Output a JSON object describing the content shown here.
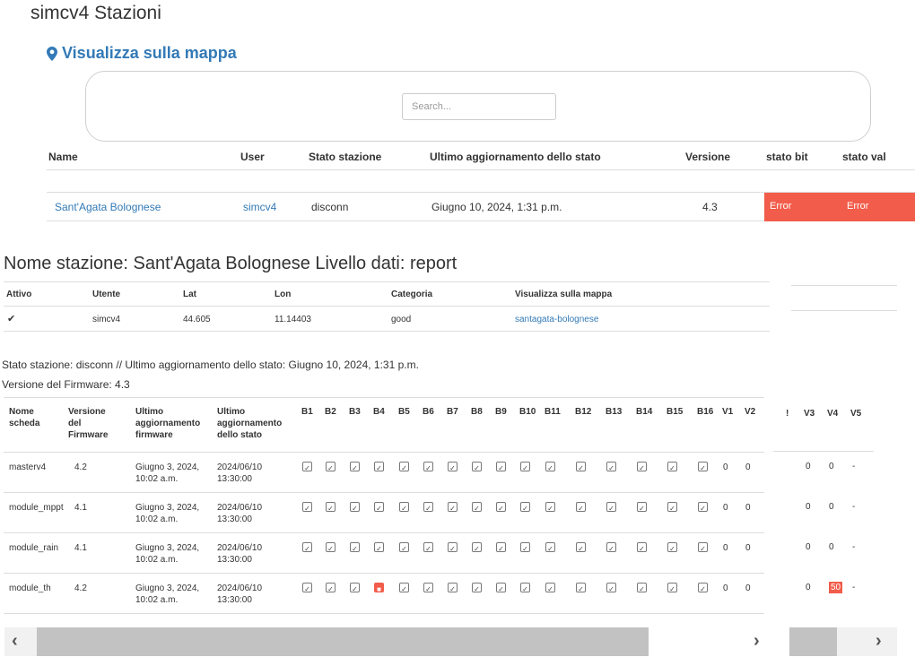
{
  "page": {
    "title": "simcv4 Stazioni",
    "map_link": "Visualizza sulla mappa",
    "search_placeholder": "Search..."
  },
  "stations_table": {
    "headers": [
      "Name",
      "User",
      "Stato stazione",
      "Ultimo aggiornamento dello stato",
      "Versione",
      "stato bit",
      "stato val"
    ],
    "rows": [
      {
        "name": "Sant'Agata Bolognese",
        "user": "simcv4",
        "stato": "disconn",
        "ultimo": "Giugno 10, 2024, 1:31 p.m.",
        "versione": "4.3",
        "stato_bit": "Error",
        "stato_val": "Error"
      }
    ]
  },
  "detail": {
    "title": "Nome stazione: Sant'Agata Bolognese Livello dati: report",
    "info_headers": [
      "Attivo",
      "Utente",
      "Lat",
      "Lon",
      "Categoria",
      "Visualizza sulla mappa"
    ],
    "info_values": {
      "attivo_icon": "checkmark-icon",
      "utente": "simcv4",
      "lat": "44.605",
      "lon": "11.14403",
      "categoria": "good",
      "mappa_link": "santagata-bolognese"
    },
    "status_line": "Stato stazione: disconn // Ultimo aggiornamento dello stato: Giugno 10, 2024, 1:31 p.m.",
    "firmware_line": "Versione del Firmware: 4.3"
  },
  "boards_table": {
    "headers": {
      "nome": "Nome\nscheda",
      "versione": "Versione\ndel\nFirmware",
      "ultimo_fw": "Ultimo\naggiornamento\nfirmware",
      "ultimo_stato": "Ultimo\naggiornamento\ndello stato",
      "bits": [
        "B1",
        "B2",
        "B3",
        "B4",
        "B5",
        "B6",
        "B7",
        "B8",
        "B9",
        "B10",
        "B11",
        "B12",
        "B13",
        "B14",
        "B15",
        "B16"
      ],
      "vals": [
        "V1",
        "V2"
      ],
      "right_vals": [
        "!",
        "V3",
        "V4",
        "V5"
      ]
    },
    "rows": [
      {
        "nome": "masterv4",
        "versione": "4.2",
        "ultimo_fw": "Giugno 3, 2024,\n10:02 a.m.",
        "ultimo_stato": "2024/06/10\n13:30:00",
        "bad_bits": [],
        "v1": "0",
        "v2": "0",
        "v3": "0",
        "v4": "0",
        "v5": "-",
        "v4_bad": false
      },
      {
        "nome": "module_mppt",
        "versione": "4.1",
        "ultimo_fw": "Giugno 3, 2024,\n10:02 a.m.",
        "ultimo_stato": "2024/06/10\n13:30:00",
        "bad_bits": [],
        "v1": "0",
        "v2": "0",
        "v3": "0",
        "v4": "0",
        "v5": "-",
        "v4_bad": false
      },
      {
        "nome": "module_rain",
        "versione": "4.1",
        "ultimo_fw": "Giugno 3, 2024,\n10:02 a.m.",
        "ultimo_stato": "2024/06/10\n13:30:00",
        "bad_bits": [],
        "v1": "0",
        "v2": "0",
        "v3": "0",
        "v4": "0",
        "v5": "-",
        "v4_bad": false
      },
      {
        "nome": "module_th",
        "versione": "4.2",
        "ultimo_fw": "Giugno 3, 2024,\n10:02 a.m.",
        "ultimo_stato": "2024/06/10\n13:30:00",
        "bad_bits": [
          3
        ],
        "v1": "0",
        "v2": "0",
        "v3": "0",
        "v4": "50",
        "v5": "-",
        "v4_bad": true
      }
    ]
  },
  "scrollbars": {
    "left_arrow_icon": "chevron-left-icon",
    "right_arrow_icon": "chevron-right-icon"
  },
  "colors": {
    "link": "#337ab7",
    "error": "#f25c4a"
  }
}
